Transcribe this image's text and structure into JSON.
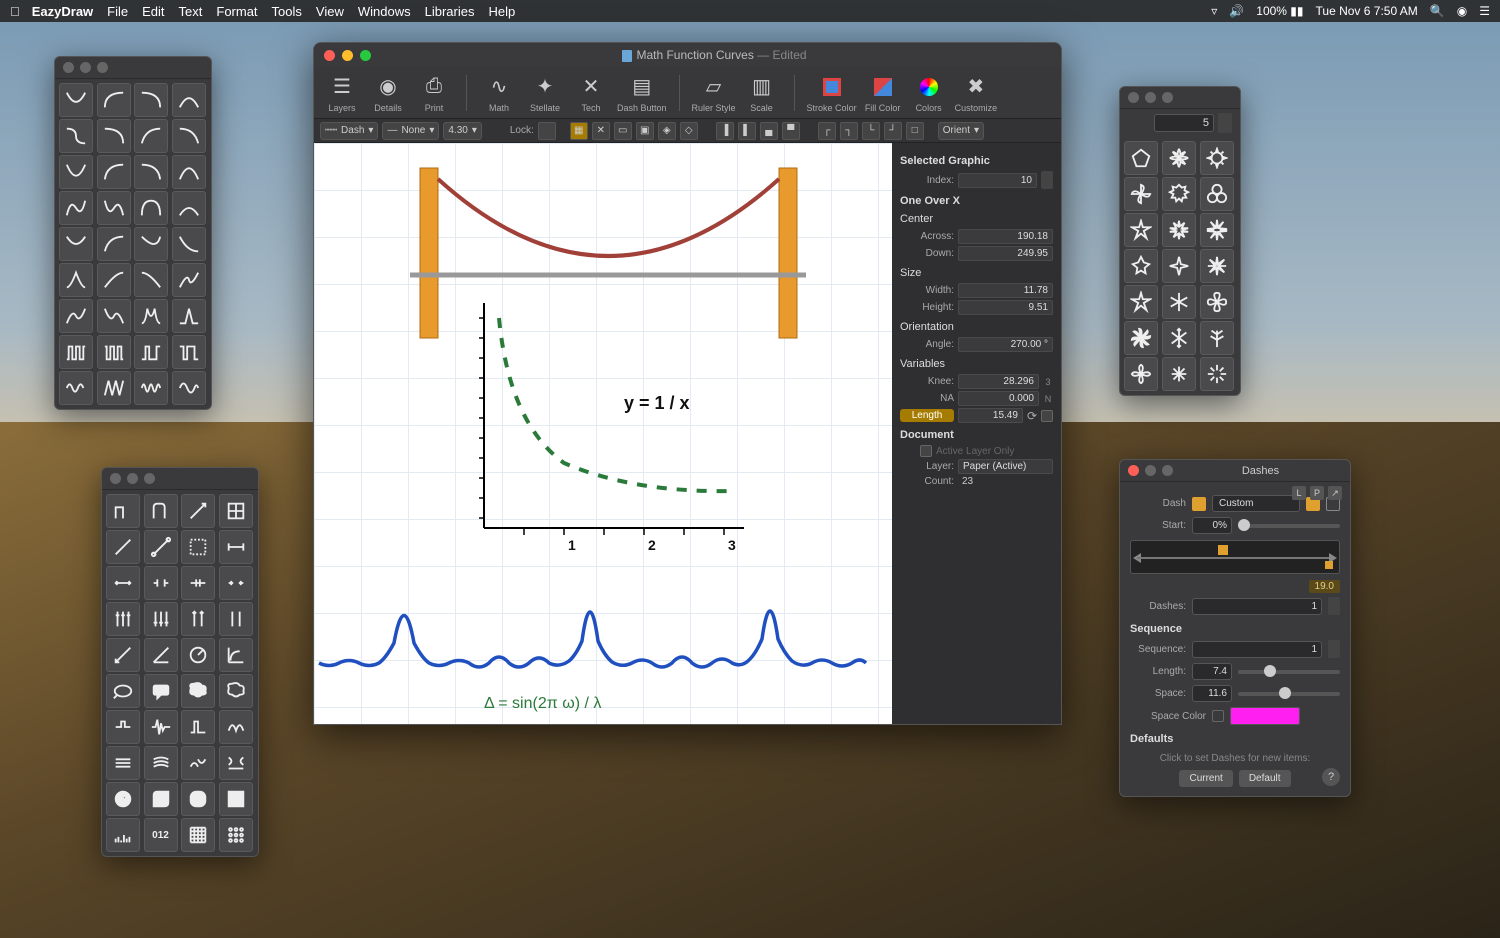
{
  "menubar": {
    "app": "EazyDraw",
    "items": [
      "File",
      "Edit",
      "Text",
      "Format",
      "Tools",
      "View",
      "Windows",
      "Libraries",
      "Help"
    ],
    "battery": "100%",
    "clock": "Tue Nov 6  7:50 AM"
  },
  "main": {
    "title": "Math  Function Curves",
    "edited": "— Edited",
    "toolbar": {
      "layers": "Layers",
      "details": "Details",
      "print": "Print",
      "math": "Math",
      "stellate": "Stellate",
      "tech": "Tech",
      "dash_button": "Dash Button",
      "ruler_style": "Ruler Style",
      "scale": "Scale",
      "stroke_color": "Stroke Color",
      "fill_color": "Fill Color",
      "colors": "Colors",
      "customize": "Customize"
    },
    "optionbar": {
      "dash_label": "Dash",
      "none_label": "None",
      "num": "4.30",
      "lock": "Lock:",
      "orient": "Orient"
    },
    "canvas": {
      "equation_y1x": "y = 1 / x",
      "equation_sine": "Δ = sin(2π ω) / λ",
      "axis_ticks": [
        "1",
        "2",
        "3"
      ]
    },
    "inspector": {
      "selected_graphic_h": "Selected Graphic",
      "index_label": "Index:",
      "index_val": "10",
      "one_over_x_h": "One Over X",
      "center_h": "Center",
      "across_label": "Across:",
      "across_val": "190.18",
      "down_label": "Down:",
      "down_val": "249.95",
      "size_h": "Size",
      "width_label": "Width:",
      "width_val": "11.78",
      "height_label": "Height:",
      "height_val": "9.51",
      "orientation_h": "Orientation",
      "angle_label": "Angle:",
      "angle_val": "270.00 °",
      "variables_h": "Variables",
      "knee_label": "Knee:",
      "knee_val": "28.296",
      "knee_side": "3",
      "na_label": "NA",
      "na_val": "0.000",
      "na_side": "N",
      "length_label": "Length",
      "length_val": "15.49",
      "document_h": "Document",
      "active_layer_only": "Active Layer Only",
      "layer_label": "Layer:",
      "layer_val": "Paper (Active)",
      "count_label": "Count:",
      "count_val": "23"
    }
  },
  "shapes_palette": {
    "count": "5"
  },
  "dashes_panel": {
    "title": "Dashes",
    "dash_label": "Dash",
    "dash_mode": "Custom",
    "start_label": "Start:",
    "start_val": "0%",
    "preview_readout": "19.0",
    "dashes_label": "Dashes:",
    "dashes_val": "1",
    "sequence_h": "Sequence",
    "sequence_label": "Sequence:",
    "sequence_val": "1",
    "length_label": "Length:",
    "length_val": "7.4",
    "space_label": "Space:",
    "space_val": "11.6",
    "space_color_label": "Space Color",
    "defaults_h": "Defaults",
    "footer_text": "Click to set Dashes for new items:",
    "current_btn": "Current",
    "default_btn": "Default"
  }
}
